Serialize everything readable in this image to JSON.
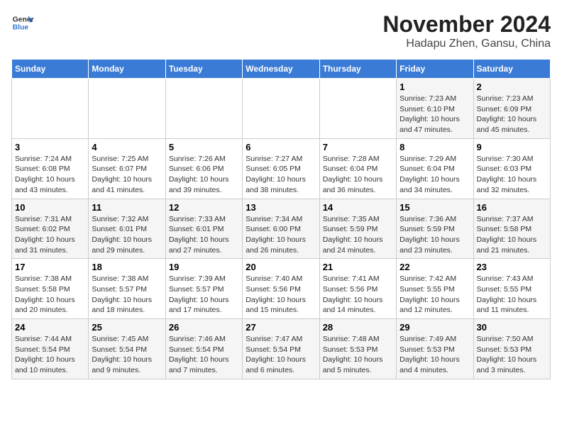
{
  "header": {
    "logo_line1": "General",
    "logo_line2": "Blue",
    "month_title": "November 2024",
    "location": "Hadapu Zhen, Gansu, China"
  },
  "weekdays": [
    "Sunday",
    "Monday",
    "Tuesday",
    "Wednesday",
    "Thursday",
    "Friday",
    "Saturday"
  ],
  "weeks": [
    [
      {
        "day": "",
        "info": ""
      },
      {
        "day": "",
        "info": ""
      },
      {
        "day": "",
        "info": ""
      },
      {
        "day": "",
        "info": ""
      },
      {
        "day": "",
        "info": ""
      },
      {
        "day": "1",
        "info": "Sunrise: 7:23 AM\nSunset: 6:10 PM\nDaylight: 10 hours and 47 minutes."
      },
      {
        "day": "2",
        "info": "Sunrise: 7:23 AM\nSunset: 6:09 PM\nDaylight: 10 hours and 45 minutes."
      }
    ],
    [
      {
        "day": "3",
        "info": "Sunrise: 7:24 AM\nSunset: 6:08 PM\nDaylight: 10 hours and 43 minutes."
      },
      {
        "day": "4",
        "info": "Sunrise: 7:25 AM\nSunset: 6:07 PM\nDaylight: 10 hours and 41 minutes."
      },
      {
        "day": "5",
        "info": "Sunrise: 7:26 AM\nSunset: 6:06 PM\nDaylight: 10 hours and 39 minutes."
      },
      {
        "day": "6",
        "info": "Sunrise: 7:27 AM\nSunset: 6:05 PM\nDaylight: 10 hours and 38 minutes."
      },
      {
        "day": "7",
        "info": "Sunrise: 7:28 AM\nSunset: 6:04 PM\nDaylight: 10 hours and 36 minutes."
      },
      {
        "day": "8",
        "info": "Sunrise: 7:29 AM\nSunset: 6:04 PM\nDaylight: 10 hours and 34 minutes."
      },
      {
        "day": "9",
        "info": "Sunrise: 7:30 AM\nSunset: 6:03 PM\nDaylight: 10 hours and 32 minutes."
      }
    ],
    [
      {
        "day": "10",
        "info": "Sunrise: 7:31 AM\nSunset: 6:02 PM\nDaylight: 10 hours and 31 minutes."
      },
      {
        "day": "11",
        "info": "Sunrise: 7:32 AM\nSunset: 6:01 PM\nDaylight: 10 hours and 29 minutes."
      },
      {
        "day": "12",
        "info": "Sunrise: 7:33 AM\nSunset: 6:01 PM\nDaylight: 10 hours and 27 minutes."
      },
      {
        "day": "13",
        "info": "Sunrise: 7:34 AM\nSunset: 6:00 PM\nDaylight: 10 hours and 26 minutes."
      },
      {
        "day": "14",
        "info": "Sunrise: 7:35 AM\nSunset: 5:59 PM\nDaylight: 10 hours and 24 minutes."
      },
      {
        "day": "15",
        "info": "Sunrise: 7:36 AM\nSunset: 5:59 PM\nDaylight: 10 hours and 23 minutes."
      },
      {
        "day": "16",
        "info": "Sunrise: 7:37 AM\nSunset: 5:58 PM\nDaylight: 10 hours and 21 minutes."
      }
    ],
    [
      {
        "day": "17",
        "info": "Sunrise: 7:38 AM\nSunset: 5:58 PM\nDaylight: 10 hours and 20 minutes."
      },
      {
        "day": "18",
        "info": "Sunrise: 7:38 AM\nSunset: 5:57 PM\nDaylight: 10 hours and 18 minutes."
      },
      {
        "day": "19",
        "info": "Sunrise: 7:39 AM\nSunset: 5:57 PM\nDaylight: 10 hours and 17 minutes."
      },
      {
        "day": "20",
        "info": "Sunrise: 7:40 AM\nSunset: 5:56 PM\nDaylight: 10 hours and 15 minutes."
      },
      {
        "day": "21",
        "info": "Sunrise: 7:41 AM\nSunset: 5:56 PM\nDaylight: 10 hours and 14 minutes."
      },
      {
        "day": "22",
        "info": "Sunrise: 7:42 AM\nSunset: 5:55 PM\nDaylight: 10 hours and 12 minutes."
      },
      {
        "day": "23",
        "info": "Sunrise: 7:43 AM\nSunset: 5:55 PM\nDaylight: 10 hours and 11 minutes."
      }
    ],
    [
      {
        "day": "24",
        "info": "Sunrise: 7:44 AM\nSunset: 5:54 PM\nDaylight: 10 hours and 10 minutes."
      },
      {
        "day": "25",
        "info": "Sunrise: 7:45 AM\nSunset: 5:54 PM\nDaylight: 10 hours and 9 minutes."
      },
      {
        "day": "26",
        "info": "Sunrise: 7:46 AM\nSunset: 5:54 PM\nDaylight: 10 hours and 7 minutes."
      },
      {
        "day": "27",
        "info": "Sunrise: 7:47 AM\nSunset: 5:54 PM\nDaylight: 10 hours and 6 minutes."
      },
      {
        "day": "28",
        "info": "Sunrise: 7:48 AM\nSunset: 5:53 PM\nDaylight: 10 hours and 5 minutes."
      },
      {
        "day": "29",
        "info": "Sunrise: 7:49 AM\nSunset: 5:53 PM\nDaylight: 10 hours and 4 minutes."
      },
      {
        "day": "30",
        "info": "Sunrise: 7:50 AM\nSunset: 5:53 PM\nDaylight: 10 hours and 3 minutes."
      }
    ]
  ]
}
